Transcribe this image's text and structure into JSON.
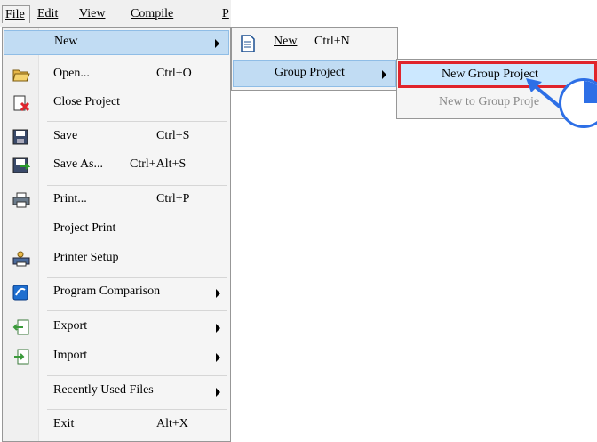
{
  "menubar": {
    "items": [
      {
        "label": "File"
      },
      {
        "label": "Edit"
      },
      {
        "label": "View"
      },
      {
        "label": "Compile"
      },
      {
        "label": "P"
      }
    ]
  },
  "file_menu": {
    "new": "New",
    "open": "Open...",
    "open_shortcut": "Ctrl+O",
    "close_project": "Close Project",
    "save": "Save",
    "save_shortcut": "Ctrl+S",
    "save_as": "Save As...",
    "save_as_shortcut": "Ctrl+Alt+S",
    "print": "Print...",
    "print_shortcut": "Ctrl+P",
    "project_print": "Project Print",
    "printer_setup": "Printer Setup",
    "program_comparison": "Program Comparison",
    "export": "Export",
    "import": "Import",
    "recently_used": "Recently Used Files",
    "exit": "Exit",
    "exit_shortcut": "Alt+X"
  },
  "new_submenu": {
    "new": "New",
    "new_shortcut": "Ctrl+N",
    "group_project": "Group Project"
  },
  "group_submenu": {
    "new_group_project": "New Group Project",
    "new_to_group_project": "New to Group Proje"
  },
  "colors": {
    "highlight": "#cce8ff",
    "highlight_border": "#99d1ff",
    "annotation_red": "#e0242c",
    "annotation_blue": "#2d6fe6"
  }
}
